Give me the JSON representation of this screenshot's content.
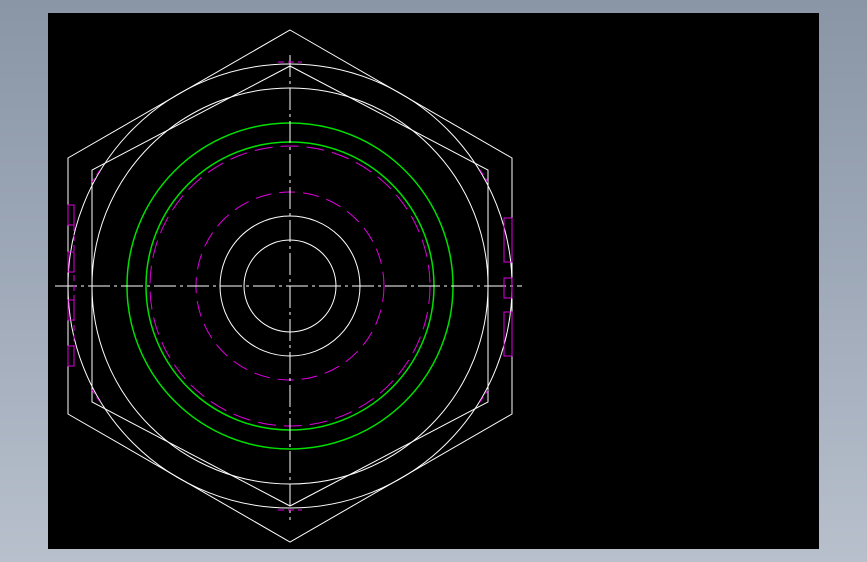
{
  "drawing": {
    "view": "front-view-hex-nut",
    "colors": {
      "background": "#000000",
      "outline": "#ffffff",
      "thread": "#00e000",
      "hidden": "#e000e0",
      "frame": "#9aa5b5"
    },
    "layers": [
      "outline",
      "thread",
      "hidden-line",
      "centerline"
    ]
  }
}
